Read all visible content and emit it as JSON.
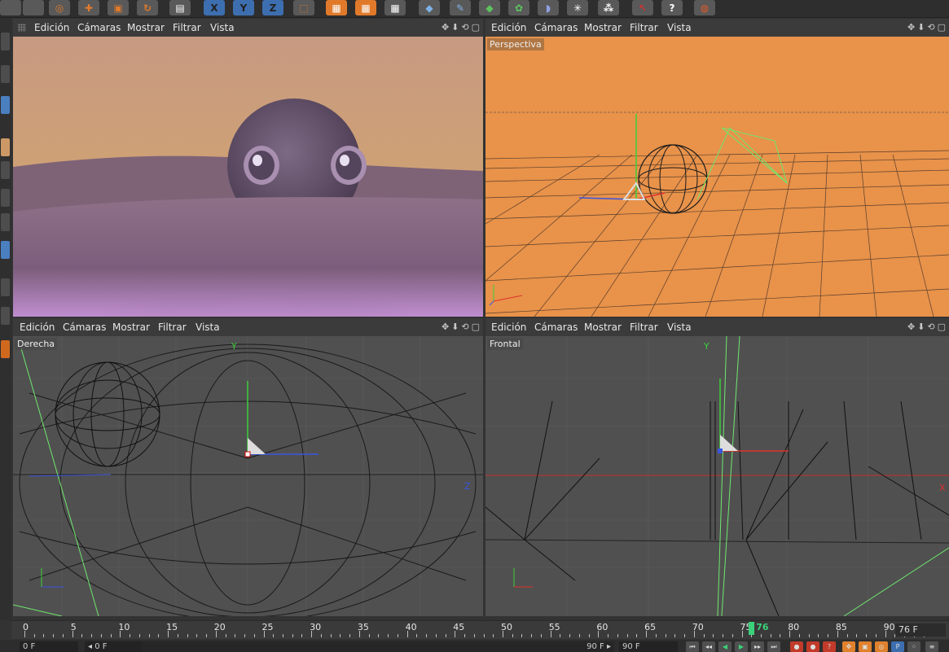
{
  "viewports": [
    {
      "id": "render",
      "label": "",
      "menu": [
        "Edición",
        "Cámaras",
        "Mostrar",
        "Filtrar",
        "Vista"
      ]
    },
    {
      "id": "perspective",
      "label": "Perspectiva",
      "menu": [
        "Edición",
        "Cámaras",
        "Mostrar",
        "Filtrar",
        "Vista"
      ]
    },
    {
      "id": "right",
      "label": "Derecha",
      "menu": [
        "Edición",
        "Cámaras",
        "Mostrar",
        "Filtrar",
        "Vista"
      ]
    },
    {
      "id": "front",
      "label": "Frontal",
      "menu": [
        "Edición",
        "Cámaras",
        "Mostrar",
        "Filtrar",
        "Vista"
      ]
    }
  ],
  "viewport_controls": [
    "✥",
    "⬇",
    "⟲",
    "▢"
  ],
  "axis_labels": {
    "x": "X",
    "y": "Y",
    "z": "Z"
  },
  "timeline": {
    "ticks": [
      "0",
      "5",
      "10",
      "15",
      "20",
      "25",
      "30",
      "35",
      "40",
      "45",
      "50",
      "55",
      "60",
      "65",
      "70",
      "75",
      "80",
      "85",
      "90"
    ],
    "current_frame_marker": "76",
    "current_frame_field": "76 F",
    "playhead_fraction": 0.8444
  },
  "bottom": {
    "start_field": "0 F",
    "range_start": "◂ 0 F",
    "range_end": "90 F ▸",
    "end_field": "90 F"
  },
  "colors": {
    "perspective_bg": "#e8924a",
    "wire_dark": "#1a1a1a",
    "axis_x": "#e0302a",
    "axis_y": "#3ad13a",
    "axis_z": "#3a55e0",
    "light_green": "#6ee86e",
    "playhead": "#3bd17a"
  },
  "icons": [
    "move-icon",
    "scale-icon",
    "rotate-icon",
    "x-axis-icon",
    "y-axis-icon",
    "z-axis-icon",
    "cube-icon",
    "render-icon",
    "light-icon"
  ]
}
